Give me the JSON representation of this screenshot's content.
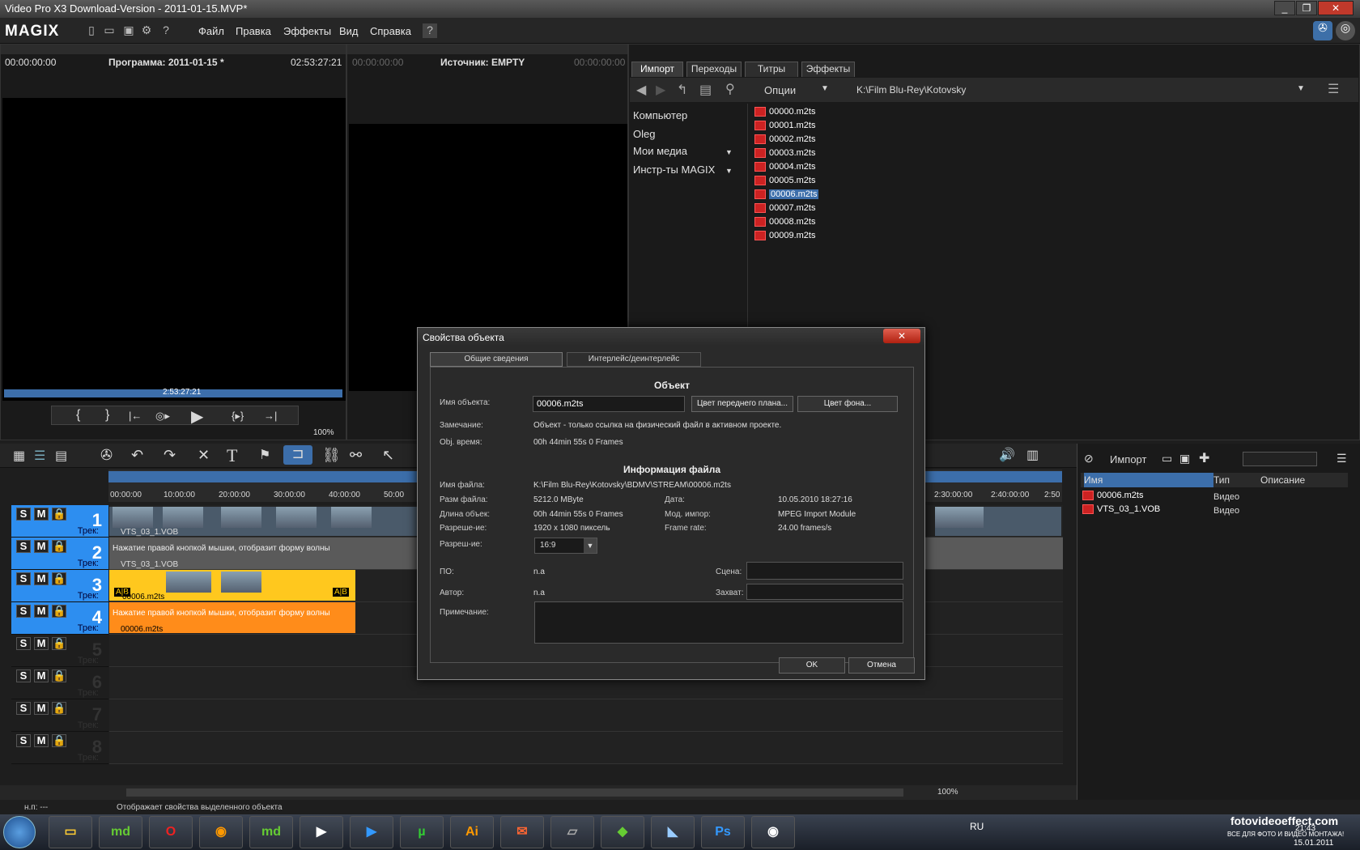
{
  "window": {
    "title": "Video Pro X3 Download-Version - 2011-01-15.MVP*"
  },
  "menubar": {
    "logo": "MAGIX",
    "items": [
      "Файл",
      "Правка",
      "Эффекты",
      "Вид",
      "Справка"
    ]
  },
  "program_monitor": {
    "timecode_left": "00:00:00:00",
    "title": "Программа: 2011-01-15 *",
    "timecode_right": "02:53:27:21",
    "position": "2:53:27:21",
    "zoom": "100%"
  },
  "source_monitor": {
    "timecode_left": "00:00:00:00",
    "title": "Источник: EMPTY",
    "timecode_right": "00:00:00:00"
  },
  "media_pool": {
    "tabs": [
      "Импорт",
      "Переходы",
      "Титры",
      "Эффекты"
    ],
    "options_label": "Опции",
    "path": "K:\\Film Blu-Rey\\Kotovsky",
    "nav": [
      "Компьютер",
      "Oleg",
      "Мои медиа",
      "Инстр-ты MAGIX"
    ],
    "files": [
      "00000.m2ts",
      "00001.m2ts",
      "00002.m2ts",
      "00003.m2ts",
      "00004.m2ts",
      "00005.m2ts",
      "00006.m2ts",
      "00007.m2ts",
      "00008.m2ts",
      "00009.m2ts"
    ],
    "selected_file": "00006.m2ts"
  },
  "timeline": {
    "ruler": [
      "00:00:00",
      "10:00:00",
      "20:00:00",
      "30:00:00",
      "40:00:00",
      "50:00",
      "2:30:00:00",
      "2:40:00:00",
      "2:50"
    ],
    "track_label": "Трек:",
    "clip_vob": "VTS_03_1.VOB",
    "clip_m2ts": "00006.m2ts",
    "waveform_hint": "Нажатие правой кнопкой мышки, отобразит форму волны",
    "ab": "A|B",
    "tracks": [
      {
        "num": "1",
        "s": "S",
        "m": "M"
      },
      {
        "num": "2",
        "s": "S",
        "m": "M"
      },
      {
        "num": "3",
        "s": "S",
        "m": "M"
      },
      {
        "num": "4",
        "s": "S",
        "m": "M"
      },
      {
        "num": "5",
        "s": "S",
        "m": "M"
      },
      {
        "num": "6",
        "s": "S",
        "m": "M"
      },
      {
        "num": "7",
        "s": "S",
        "m": "M"
      },
      {
        "num": "8",
        "s": "S",
        "m": "M"
      }
    ],
    "zoom": "100%"
  },
  "dialog": {
    "title": "Свойства объекта",
    "tabs": [
      "Общие сведения",
      "Интерлейс/деинтерлейс"
    ],
    "section_object": "Объект",
    "object_name_label": "Имя объекта:",
    "object_name": "00006.m2ts",
    "fg_color_btn": "Цвет переднего плана...",
    "bg_color_btn": "Цвет фона...",
    "remark_label": "Замечание:",
    "remark": "Объект - только ссылка на физический файл в активном проекте.",
    "objtime_label": "Obj. время:",
    "objtime": "00h 44min 55s 0 Frames",
    "section_file": "Информация файла",
    "filename_label": "Имя файла:",
    "filename": "K:\\Film Blu-Rey\\Kotovsky\\BDMV\\STREAM\\00006.m2ts",
    "filesize_label": "Разм файла:",
    "filesize": "5212.0 MByte",
    "date_label": "Дата:",
    "date": "10.05.2010 18:27:16",
    "length_label": "Длина объек:",
    "length": "00h 44min 55s 0 Frames",
    "module_label": "Мод. импор:",
    "module": "MPEG Import Module",
    "resolution_label": "Разреше-ие:",
    "resolution": "1920 x 1080 пиксель",
    "framerate_label": "Frame rate:",
    "framerate": "24.00 frames/s",
    "aspect_label": "Разреш-ие:",
    "aspect": "16:9",
    "po_label": "ПО:",
    "po": "n.a",
    "scene_label": "Сцена:",
    "author_label": "Автор:",
    "author": "n.a",
    "capture_label": "Захват:",
    "note_label": "Примечание:",
    "ok": "OK",
    "cancel": "Отмена"
  },
  "right_panel": {
    "title": "Импорт",
    "columns": [
      "Имя",
      "Тип",
      "Описание"
    ],
    "rows": [
      {
        "name": "00006.m2ts",
        "type": "Видео"
      },
      {
        "name": "VTS_03_1.VOB",
        "type": "Видео"
      }
    ]
  },
  "statusbar": {
    "left": "н.п: ---",
    "message": "Отображает свойства выделенного объекта"
  },
  "taskbar": {
    "lang": "RU",
    "time": "21:43",
    "date": "15.01.2011",
    "watermark": "fotovideoeffect.com",
    "watermark_sub": "ВСЕ ДЛЯ ФОТО И ВИДЕО МОНТАЖА!"
  }
}
